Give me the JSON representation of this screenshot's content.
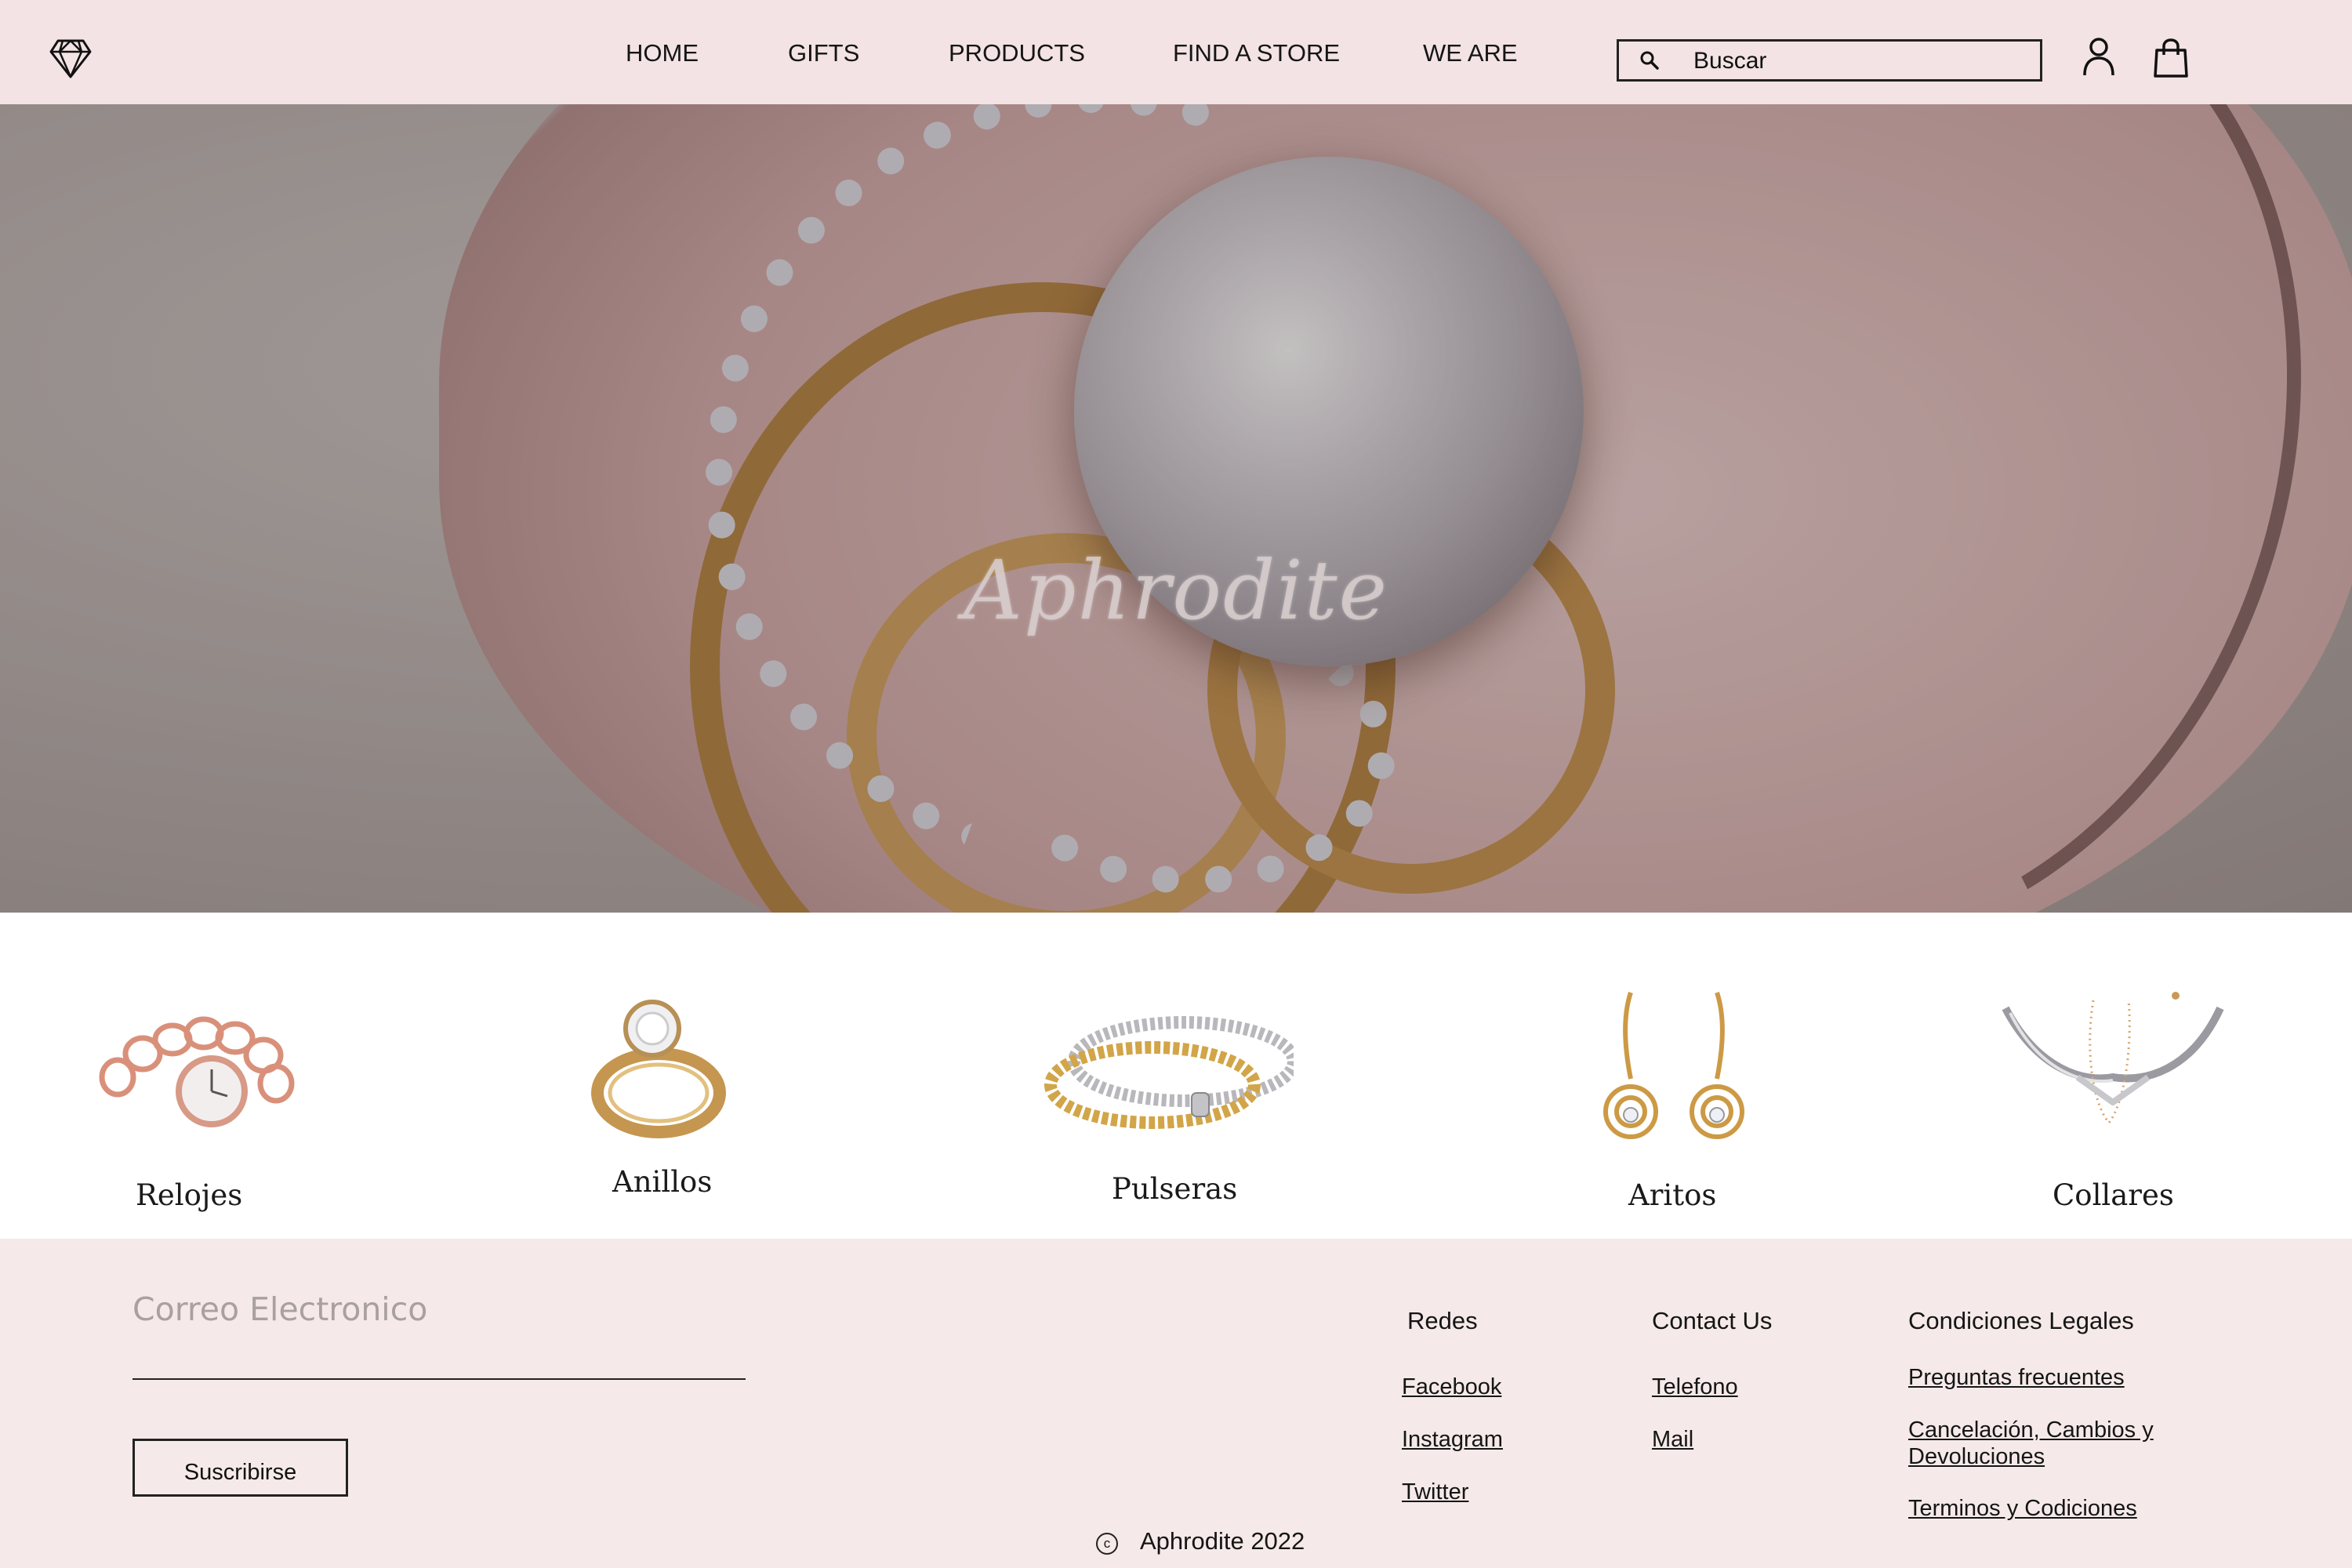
{
  "header": {
    "nav": [
      "HOME",
      "GIFTS",
      "PRODUCTS",
      "FIND A STORE",
      "WE ARE"
    ],
    "search": {
      "placeholder": "Buscar"
    },
    "icons": [
      "diamond-logo-icon",
      "search-icon",
      "user-icon",
      "shopping-bag-icon"
    ]
  },
  "hero": {
    "title": "Aphrodite"
  },
  "categories": [
    {
      "label": "Relojes"
    },
    {
      "label": "Anillos"
    },
    {
      "label": "Pulseras"
    },
    {
      "label": "Aritos"
    },
    {
      "label": "Collares"
    }
  ],
  "footer": {
    "email_label": "Correo Electronico",
    "subscribe_label": "Suscribirse",
    "redes": {
      "title": "Redes",
      "links": [
        "Facebook",
        "Instagram",
        "Twitter"
      ]
    },
    "contact": {
      "title": "Contact Us",
      "links": [
        "Telefono",
        "Mail"
      ]
    },
    "legal": {
      "title": "Condiciones Legales",
      "links": [
        "Preguntas frecuentes",
        "Cancelación, Cambios y Devoluciones",
        "Terminos y Codiciones"
      ]
    },
    "copyright": "Aphrodite 2022"
  },
  "colors": {
    "header_bg": "#f3e3e4",
    "footer_bg": "#f5eae9",
    "gold": "#c9964f",
    "rose_gold": "#d9907a"
  }
}
